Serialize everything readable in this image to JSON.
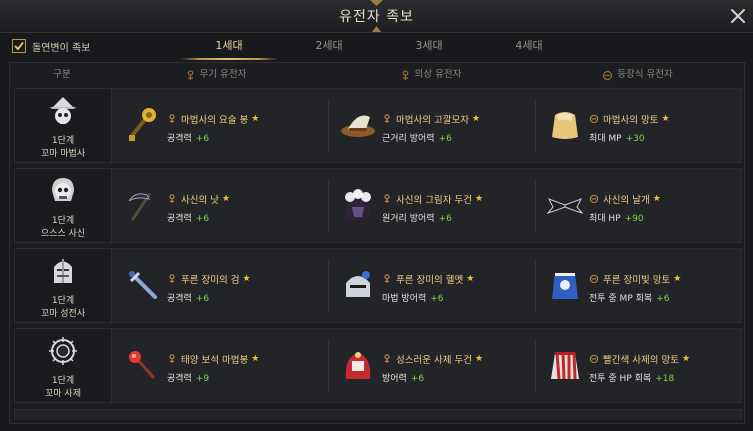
{
  "window": {
    "title": "유전자 족보"
  },
  "filter": {
    "label": "돌연변이 족보",
    "checked": true
  },
  "tabs": [
    {
      "label": "1세대",
      "active": true
    },
    {
      "label": "2세대",
      "active": false
    },
    {
      "label": "3세대",
      "active": false
    },
    {
      "label": "4세대",
      "active": false
    }
  ],
  "table": {
    "headers": {
      "class": "구분",
      "weapon": "무기 유전자",
      "costume": "의상 유전자",
      "accessory": "등장식 유전자"
    },
    "rows": [
      {
        "stage": "1단계",
        "class_name": "꼬마 마법사",
        "class_icon": "witch-skull-icon",
        "weapon": {
          "name": "마법사의 요술 봉",
          "stat": "공격력",
          "value": "+6",
          "icon": "magic-wand-icon"
        },
        "costume": {
          "name": "마법사의 고깔모자",
          "stat": "근거리 방어력",
          "value": "+6",
          "icon": "witch-hat-icon"
        },
        "accessory": {
          "name": "마법사의 망토",
          "stat": "최대 MP",
          "value": "+30",
          "icon": "cape-icon"
        }
      },
      {
        "stage": "1단계",
        "class_name": "으스스 사신",
        "class_icon": "reaper-skull-icon",
        "weapon": {
          "name": "사신의 낫",
          "stat": "공격력",
          "value": "+6",
          "icon": "scythe-icon"
        },
        "costume": {
          "name": "사신의 그림자 두건",
          "stat": "원거리 방어력",
          "value": "+6",
          "icon": "shadow-hood-icon"
        },
        "accessory": {
          "name": "사신의 날개",
          "stat": "최대 HP",
          "value": "+90",
          "icon": "bat-wings-icon"
        }
      },
      {
        "stage": "1단계",
        "class_name": "꼬마 성전사",
        "class_icon": "crusader-helmet-icon",
        "weapon": {
          "name": "푸른 장미의 검",
          "stat": "공격력",
          "value": "+6",
          "icon": "sword-icon"
        },
        "costume": {
          "name": "푸른 장미의 헬멧",
          "stat": "마법 방어력",
          "value": "+6",
          "icon": "helmet-icon"
        },
        "accessory": {
          "name": "푸른 장미빛 망토",
          "stat": "전투 중 MP 회복",
          "value": "+6",
          "icon": "blue-cape-icon"
        }
      },
      {
        "stage": "1단계",
        "class_name": "꼬마 사제",
        "class_icon": "priest-emblem-icon",
        "weapon": {
          "name": "태양 보석 마법봉",
          "stat": "공격력",
          "value": "+9",
          "icon": "sun-staff-icon"
        },
        "costume": {
          "name": "성스러운 사제 두건",
          "stat": "방어력",
          "value": "+6",
          "icon": "priest-hood-icon"
        },
        "accessory": {
          "name": "빨간색 사제의 망토",
          "stat": "전투 중 HP 회복",
          "value": "+18",
          "icon": "red-cape-icon"
        }
      }
    ]
  },
  "colors": {
    "gold": "#f0d08a",
    "stat_green": "#7fd84a",
    "star": "#f0c33c"
  }
}
